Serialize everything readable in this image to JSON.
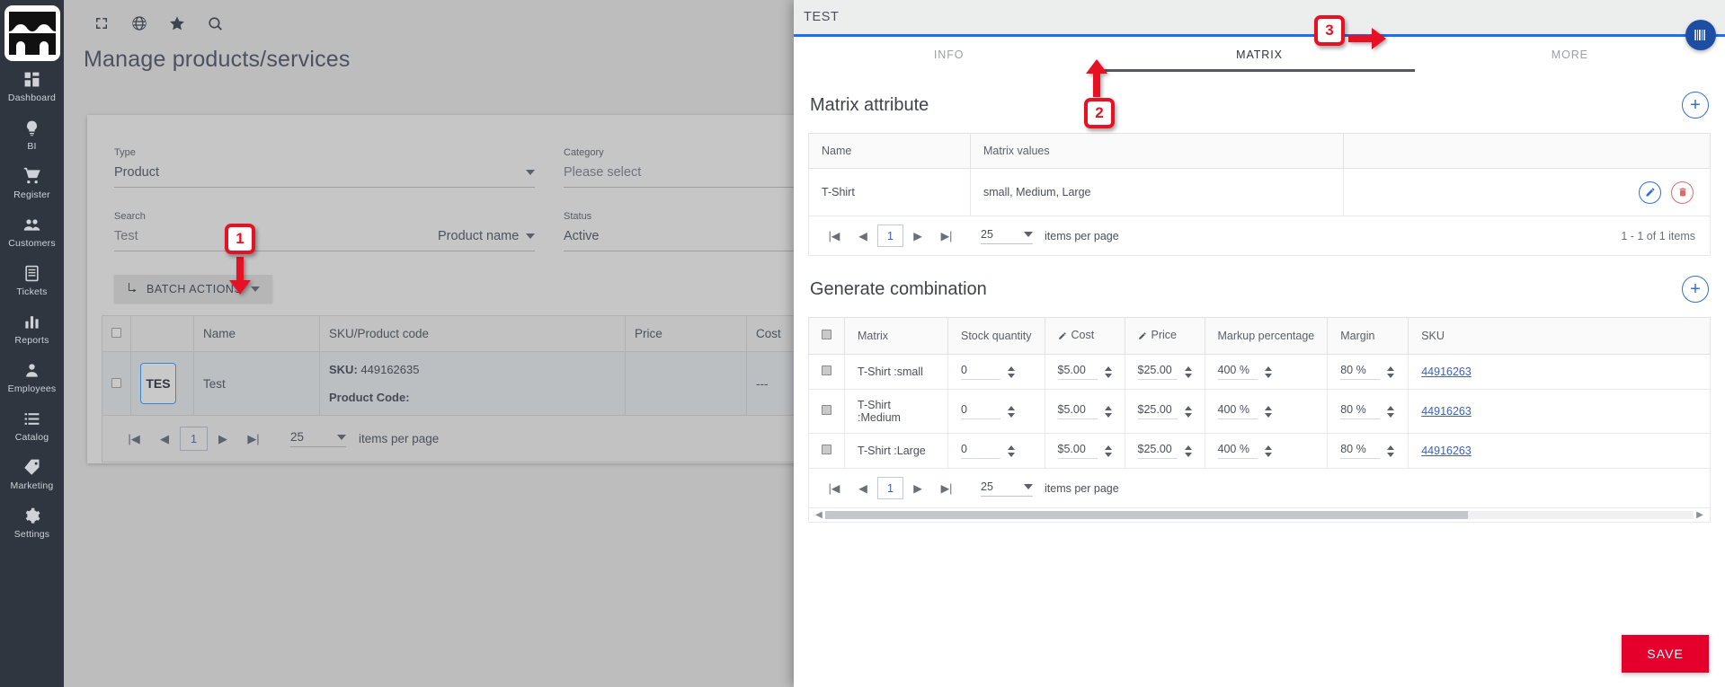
{
  "sidebar": {
    "logo_name": "store-logo",
    "items": [
      {
        "label": "Dashboard",
        "icon": "dashboard-icon"
      },
      {
        "label": "BI",
        "icon": "lightbulb-icon"
      },
      {
        "label": "Register",
        "icon": "cart-icon"
      },
      {
        "label": "Customers",
        "icon": "people-icon"
      },
      {
        "label": "Tickets",
        "icon": "ticket-icon"
      },
      {
        "label": "Reports",
        "icon": "bar-chart-icon"
      },
      {
        "label": "Employees",
        "icon": "person-icon"
      },
      {
        "label": "Catalog",
        "icon": "list-icon"
      },
      {
        "label": "Marketing",
        "icon": "tag-icon"
      },
      {
        "label": "Settings",
        "icon": "gear-icon"
      }
    ]
  },
  "topbar": {
    "icons": [
      "fullscreen-icon",
      "globe-icon",
      "star-icon",
      "search-icon"
    ]
  },
  "page": {
    "title": "Manage products/services"
  },
  "filters": {
    "type": {
      "label": "Type",
      "value": "Product"
    },
    "category": {
      "label": "Category",
      "value": "Please select"
    },
    "search": {
      "label": "Search",
      "value": "Test"
    },
    "search_by": {
      "value": "Product name"
    },
    "status": {
      "label": "Status",
      "value": "Active"
    },
    "batch_actions_label": "BATCH ACTIONS"
  },
  "products_table": {
    "columns": [
      "",
      "",
      "Name",
      "SKU/Product code",
      "Price",
      "Cost"
    ],
    "rows": [
      {
        "thumb": "TES",
        "name": "Test",
        "sku_label": "SKU:",
        "sku_value": "449162635",
        "product_code_label": "Product Code:",
        "product_code_value": "",
        "price": "",
        "cost": "---"
      }
    ],
    "pager": {
      "page": "1",
      "page_size": "25",
      "items_per_page_label": "items per page"
    }
  },
  "panel": {
    "title": "TEST",
    "accent_color": "#1b6ff0",
    "tabs": [
      {
        "label": "INFO",
        "active": false
      },
      {
        "label": "MATRIX",
        "active": true
      },
      {
        "label": "MORE",
        "active": false
      }
    ],
    "barcode_button": "barcode-icon",
    "matrix_attribute": {
      "title": "Matrix attribute",
      "add_label": "+",
      "columns": [
        "Name",
        "Matrix values",
        ""
      ],
      "rows": [
        {
          "name": "T-Shirt",
          "values": "small, Medium, Large"
        }
      ],
      "pager": {
        "page": "1",
        "page_size": "25",
        "items_per_page_label": "items per page",
        "count_label": "1 - 1 of 1 items"
      }
    },
    "generate_combination": {
      "title": "Generate combination",
      "add_label": "+",
      "columns": [
        "",
        "Matrix",
        "Stock quantity",
        "Cost",
        "Price",
        "Markup percentage",
        "Margin",
        "SKU"
      ],
      "rows": [
        {
          "matrix": "T-Shirt :small",
          "stock": "0",
          "cost": "$5.00",
          "price": "$25.00",
          "markup": "400 %",
          "margin": "80 %",
          "sku": "44916263"
        },
        {
          "matrix": "T-Shirt :Medium",
          "stock": "0",
          "cost": "$5.00",
          "price": "$25.00",
          "markup": "400 %",
          "margin": "80 %",
          "sku": "44916263"
        },
        {
          "matrix": "T-Shirt :Large",
          "stock": "0",
          "cost": "$5.00",
          "price": "$25.00",
          "markup": "400 %",
          "margin": "80 %",
          "sku": "44916263"
        }
      ],
      "pager": {
        "page": "1",
        "page_size": "25",
        "items_per_page_label": "items per page"
      }
    },
    "save_label": "SAVE",
    "save_color": "#e4002b"
  },
  "annotations": [
    {
      "number": "1"
    },
    {
      "number": "2"
    },
    {
      "number": "3"
    }
  ]
}
